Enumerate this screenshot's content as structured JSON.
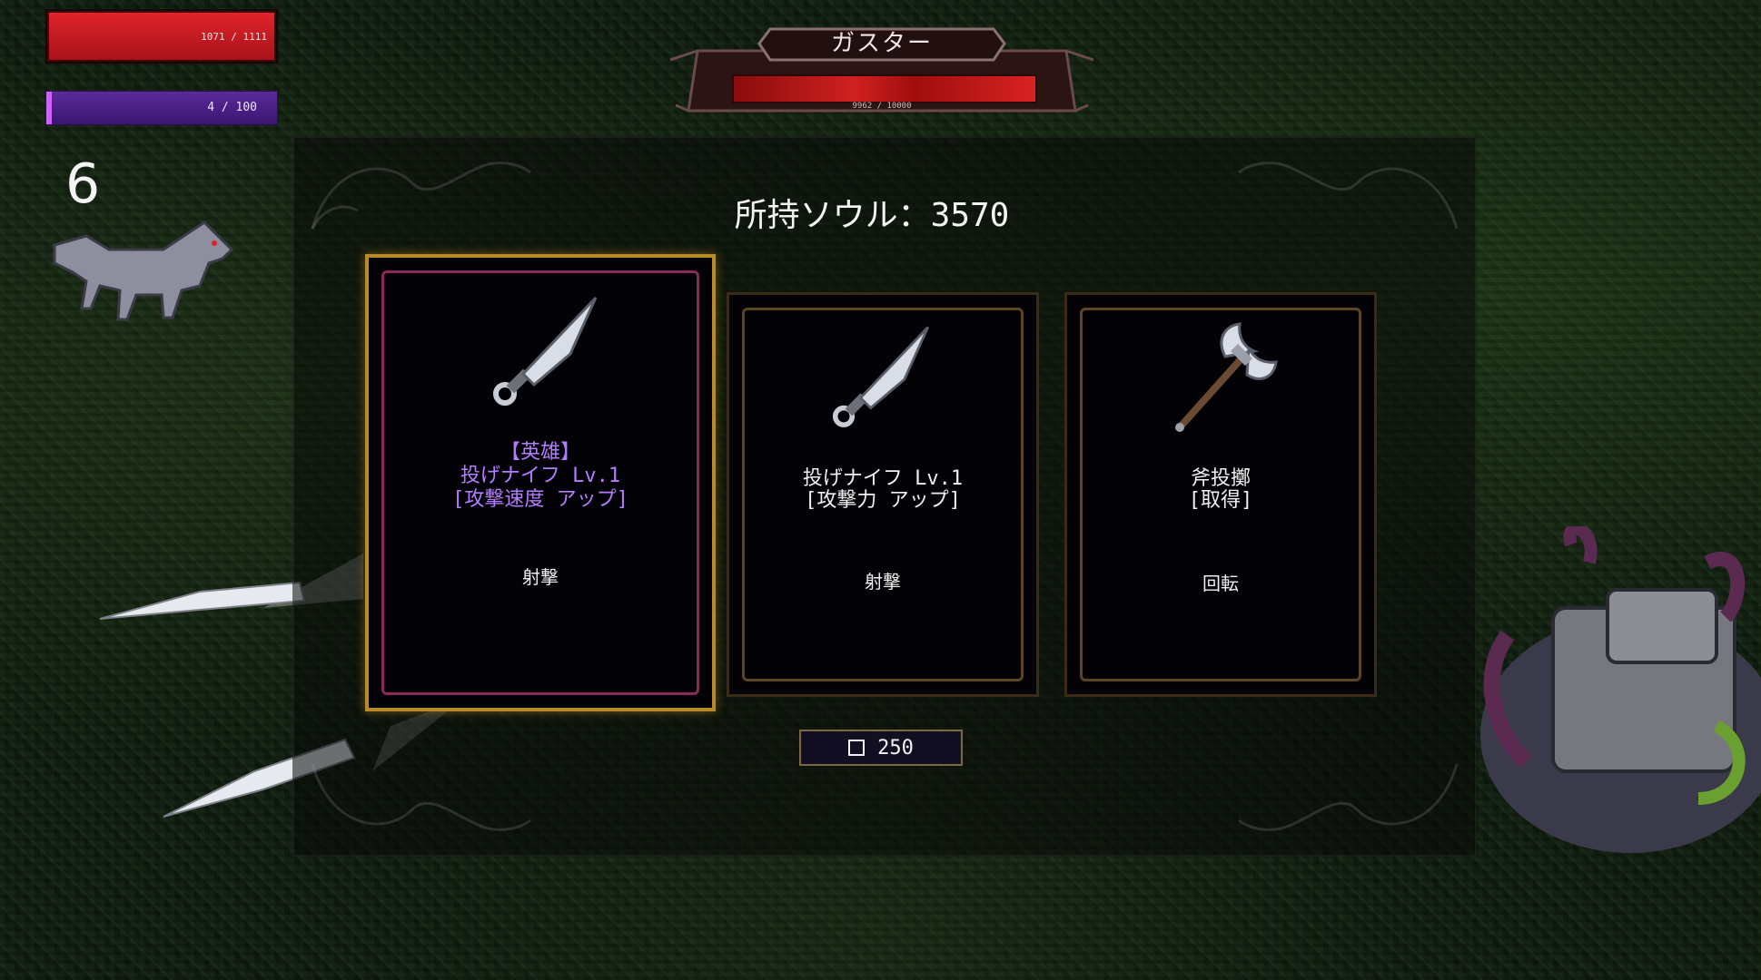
{
  "hud": {
    "hp_text": "1071 / 1111",
    "hp_fraction": 0.96,
    "mp_text": "4 / 100",
    "level": "6"
  },
  "boss": {
    "name": "ガスター",
    "hp_text": "9962 / 10000",
    "hp_fraction": 0.996
  },
  "souls": {
    "label": "所持ソウル：3570"
  },
  "cards": [
    {
      "rarity": "【英雄】",
      "name": "投げナイフ Lv.1",
      "effect": "[攻撃速度 アップ]",
      "type": "射撃",
      "icon": "throwing-knife-icon",
      "selected": true,
      "title_color": "#b47cff"
    },
    {
      "name": "投げナイフ Lv.1",
      "effect": "[攻撃力 アップ]",
      "type": "射撃",
      "icon": "throwing-knife-icon",
      "selected": false
    },
    {
      "name": "斧投擲",
      "effect": "[取得]",
      "type": "回転",
      "icon": "battle-axe-icon",
      "selected": false
    }
  ],
  "reroll": {
    "cost": "250",
    "icon": "square-icon"
  }
}
